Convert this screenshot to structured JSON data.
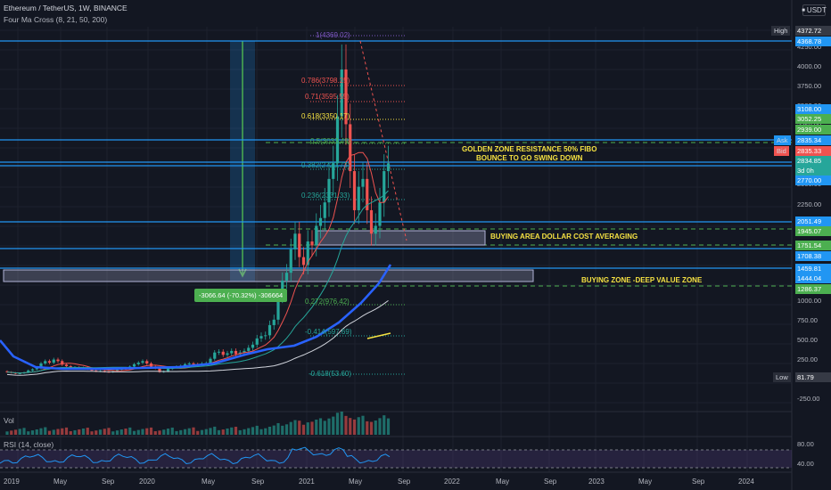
{
  "header": {
    "title": "Ethereum / TetherUS, 1W, BINANCE",
    "indicator": "Four Ma Cross (8, 21, 50, 200)",
    "currency": "USDT"
  },
  "colors": {
    "background": "#131722",
    "blue_line": "#2196f3",
    "green_dash": "#4caf50",
    "annotation_yellow": "#f5e142",
    "ma_blue": "#2962ff",
    "rsi_line": "#2196f3",
    "measure_green": "#4caf50"
  },
  "fib_levels": [
    {
      "label": "1(4369.02)",
      "color": "#7e57c2"
    },
    {
      "label": "0.786(3798.25)",
      "color": "#ef5350"
    },
    {
      "label": "0.71(3595.55)",
      "color": "#ef5350"
    },
    {
      "label": "0.618(3350.17)",
      "color": "#f5e142"
    },
    {
      "label": "0.5(3033.49)",
      "color": "#4caf50"
    },
    {
      "label": "0.382(2720.73)",
      "color": "#26a69a"
    },
    {
      "label": "0.236(2331.33)",
      "color": "#26a69a"
    },
    {
      "label": "0.272(976.42)",
      "color": "#4caf50"
    },
    {
      "label": "-0.414(597.69)",
      "color": "#26a69a"
    },
    {
      "label": "-0.618(53.60)",
      "color": "#26a69a"
    }
  ],
  "annotations": {
    "golden_zone": "GOLDEN ZONE  RESISTANCE 50% FIBO",
    "bounce": "BOUNCE TO GO SWING DOWN",
    "buying_area": "BUYING AREA DOLLAR COST AVERAGING",
    "buying_zone": "BUYING ZONE -DEEP VALUE ZONE",
    "measure": "-3066.64 (-70.32%) -306664"
  },
  "y_axis": {
    "ticks": [
      "4250.00",
      "4000.00",
      "3750.00",
      "3500.00",
      "3250.00",
      "2750.00",
      "2500.00",
      "2250.00",
      "1250.00",
      "1000.00",
      "750.00",
      "500.00",
      "250.00",
      "0.00",
      "-250.00"
    ],
    "tags": [
      {
        "label": "High",
        "value": "4372.72",
        "bg": "#363a45"
      },
      {
        "label": "",
        "value": "4368.78",
        "bg": "#2196f3"
      },
      {
        "label": "",
        "value": "3108.00",
        "bg": "#2196f3"
      },
      {
        "label": "",
        "value": "3052.25",
        "bg": "#4caf50"
      },
      {
        "label": "",
        "value": "2939.00",
        "bg": "#4caf50"
      },
      {
        "label": "Ask",
        "value": "2835.34",
        "bg": "#2196f3"
      },
      {
        "label": "Bid",
        "value": "2835.33",
        "bg": "#ef5350"
      },
      {
        "label": "",
        "value": "2834.85",
        "bg": "#26a69a"
      },
      {
        "label": "",
        "value": "3d 0h",
        "bg": "#26a69a"
      },
      {
        "label": "",
        "value": "2770.00",
        "bg": "#2196f3"
      },
      {
        "label": "",
        "value": "2051.49",
        "bg": "#2196f3"
      },
      {
        "label": "",
        "value": "1945.07",
        "bg": "#4caf50"
      },
      {
        "label": "",
        "value": "1751.54",
        "bg": "#4caf50"
      },
      {
        "label": "",
        "value": "1708.38",
        "bg": "#2196f3"
      },
      {
        "label": "",
        "value": "1459.81",
        "bg": "#2196f3"
      },
      {
        "label": "",
        "value": "1444.04",
        "bg": "#2196f3"
      },
      {
        "label": "",
        "value": "1286.37",
        "bg": "#4caf50"
      },
      {
        "label": "Low",
        "value": "81.79",
        "bg": "#363a45"
      }
    ],
    "rsi_ticks": [
      "80.00",
      "40.00"
    ]
  },
  "x_axis": {
    "ticks": [
      "2019",
      "May",
      "Sep",
      "2020",
      "May",
      "Sep",
      "2021",
      "May",
      "Sep",
      "2022",
      "May",
      "Sep",
      "2023",
      "May",
      "Sep",
      "2024"
    ]
  },
  "panes": {
    "volume_label": "Vol",
    "rsi_label": "RSI (14, close)"
  }
}
